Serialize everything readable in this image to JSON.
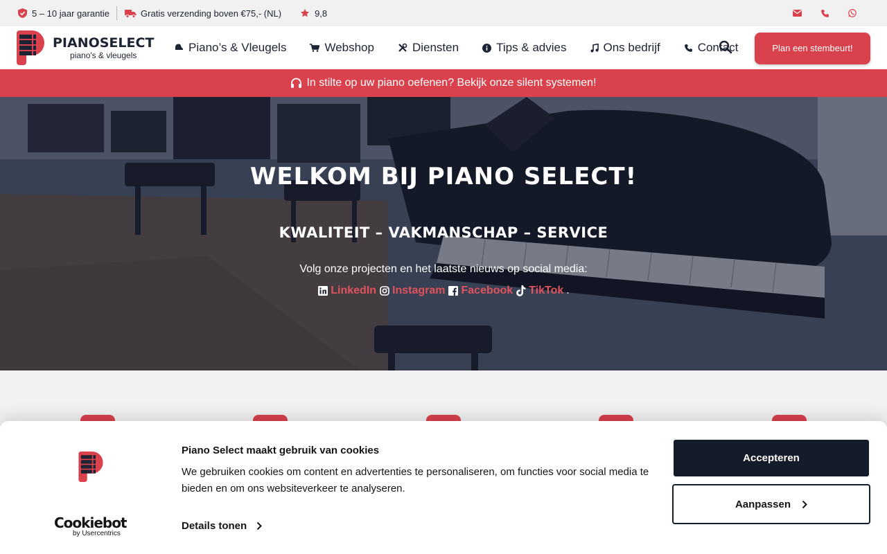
{
  "topbar": {
    "guarantee": "5 – 10 jaar garantie",
    "shipping": "Gratis verzending boven €75,- (NL)",
    "rating": "9,8",
    "icons": [
      "shield-check-icon",
      "truck-icon",
      "star-icon",
      "envelope-icon",
      "phone-icon",
      "whatsapp-icon"
    ]
  },
  "header": {
    "brand": "PIANOSELECT",
    "tagline": "piano's & vleugels",
    "nav": [
      {
        "label": "Piano’s & Vleugels",
        "icon": "piano-icon"
      },
      {
        "label": "Webshop",
        "icon": "cart-icon"
      },
      {
        "label": "Diensten",
        "icon": "tools-icon"
      },
      {
        "label": "Tips & advies",
        "icon": "info-icon"
      },
      {
        "label": "Ons bedrijf",
        "icon": "music-note-icon"
      },
      {
        "label": "Contact",
        "icon": "phone-icon"
      }
    ],
    "cta": "Plan een stembeurt!"
  },
  "banner": {
    "text": "In stilte op uw piano oefenen? Bekijk onze silent systemen!",
    "icon": "headphones-icon"
  },
  "hero": {
    "title": "WELKOM BIJ PIANO SELECT!",
    "subtitle": "KWALITEIT – VAKMANSCHAP – SERVICE",
    "follow": "Volg onze projecten en het laatste nieuws op social media:",
    "social": [
      {
        "label": "LinkedIn",
        "icon": "linkedin-icon"
      },
      {
        "label": "Instagram",
        "icon": "instagram-icon"
      },
      {
        "label": "Facebook",
        "icon": "facebook-icon"
      },
      {
        "label": "TikTok",
        "icon": "tiktok-icon"
      }
    ],
    "social_end": "."
  },
  "cookie": {
    "title": "Piano Select maakt gebruik van cookies",
    "text": "We gebruiken cookies om content en advertenties te personaliseren, om functies voor social media te bieden en om ons websiteverkeer te analyseren.",
    "details": "Details tonen",
    "accept": "Accepteren",
    "customize": "Aanpassen",
    "provider": "Cookiebot",
    "provider_by": "by Usercentrics"
  },
  "colors": {
    "accent": "#d9414d",
    "dark": "#1c2333",
    "button_dark": "#141b29"
  }
}
